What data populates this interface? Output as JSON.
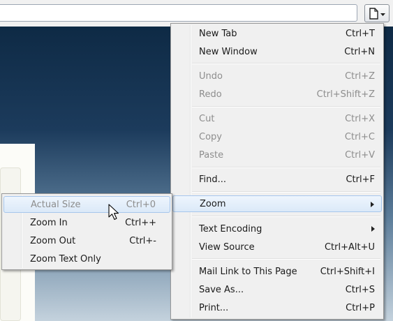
{
  "main_menu": {
    "items": [
      {
        "label": "New Tab",
        "shortcut": "Ctrl+T"
      },
      {
        "label": "New Window",
        "shortcut": "Ctrl+N"
      },
      {
        "label": "Undo",
        "shortcut": "Ctrl+Z"
      },
      {
        "label": "Redo",
        "shortcut": "Ctrl+Shift+Z"
      },
      {
        "label": "Cut",
        "shortcut": "Ctrl+X"
      },
      {
        "label": "Copy",
        "shortcut": "Ctrl+C"
      },
      {
        "label": "Paste",
        "shortcut": "Ctrl+V"
      },
      {
        "label": "Find...",
        "shortcut": "Ctrl+F"
      },
      {
        "label": "Zoom",
        "shortcut": ""
      },
      {
        "label": "Text Encoding",
        "shortcut": ""
      },
      {
        "label": "View Source",
        "shortcut": "Ctrl+Alt+U"
      },
      {
        "label": "Mail Link to This Page",
        "shortcut": "Ctrl+Shift+I"
      },
      {
        "label": "Save As...",
        "shortcut": "Ctrl+S"
      },
      {
        "label": "Print...",
        "shortcut": "Ctrl+P"
      }
    ]
  },
  "zoom_submenu": {
    "items": [
      {
        "label": "Actual Size",
        "shortcut": "Ctrl+0"
      },
      {
        "label": "Zoom In",
        "shortcut": "Ctrl++"
      },
      {
        "label": "Zoom Out",
        "shortcut": "Ctrl+-"
      },
      {
        "label": "Zoom Text Only",
        "shortcut": ""
      }
    ]
  },
  "icons": {
    "page_menu": "page-icon",
    "submenu_arrow": "chevron-right-icon",
    "cursor": "mouse-pointer-icon"
  },
  "colors": {
    "highlight_border": "#a6c6ec",
    "disabled_text": "#8d8d8d"
  }
}
